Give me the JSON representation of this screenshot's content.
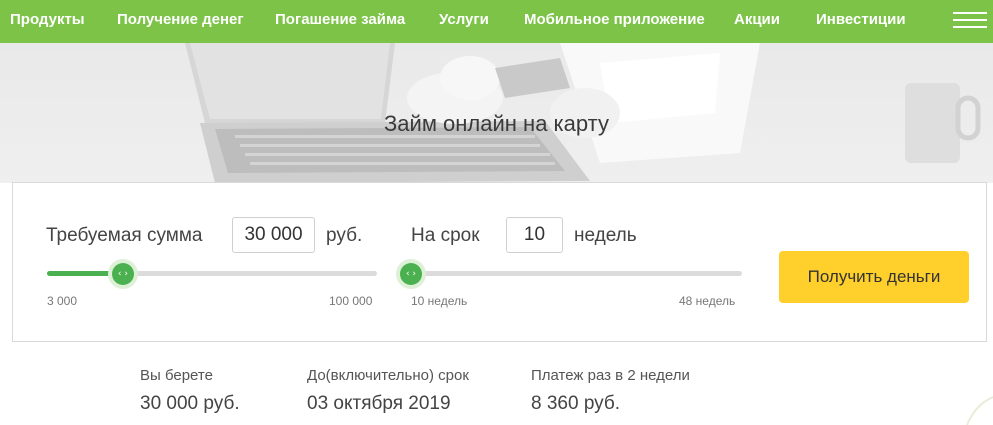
{
  "nav": {
    "items": [
      {
        "label": "Продукты"
      },
      {
        "label": "Получение денег"
      },
      {
        "label": "Погашение займа"
      },
      {
        "label": "Услуги"
      },
      {
        "label": "Мобильное приложение"
      },
      {
        "label": "Акции"
      },
      {
        "label": "Инвестиции"
      }
    ],
    "menu_icon": "hamburger-menu-icon"
  },
  "hero": {
    "title": "Займ онлайн на карту"
  },
  "calculator": {
    "amount": {
      "label": "Требуемая сумма",
      "value": "30 000",
      "unit": "руб.",
      "min_label": "3 000",
      "max_label": "100 000",
      "slider_fraction": 0.23
    },
    "term": {
      "label": "На срок",
      "value": "10",
      "unit": "недель",
      "min_label": "10 недель",
      "max_label": "48 недель",
      "slider_fraction": 0.0
    },
    "submit_label": "Получить деньги",
    "colors": {
      "accent_green": "#4bb04f",
      "nav_green": "#7cc347",
      "cta_yellow": "#ffcf2b"
    }
  },
  "summary": {
    "items": [
      {
        "label": "Вы берете",
        "value": "30 000 руб."
      },
      {
        "label": "До(включительно) срок",
        "value": "03 октября 2019"
      },
      {
        "label": "Платеж раз в 2 недели",
        "value": "8 360 руб."
      }
    ]
  }
}
